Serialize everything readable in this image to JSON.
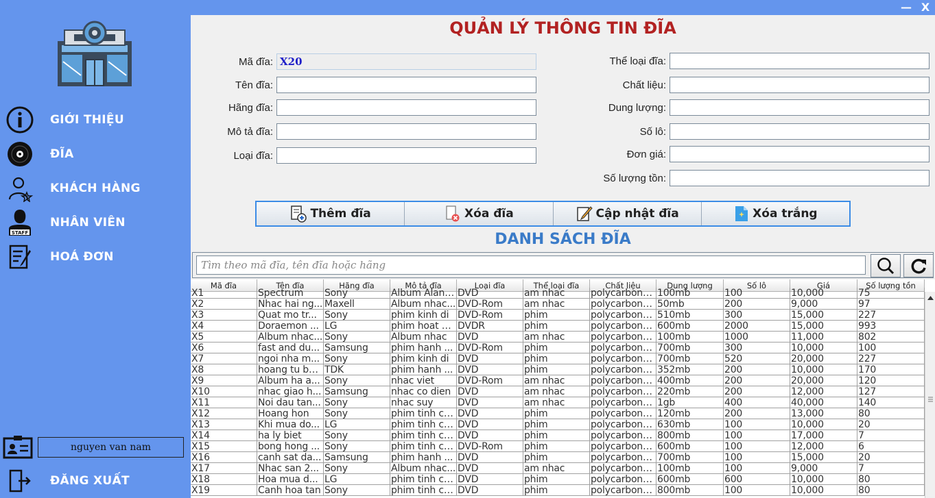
{
  "window": {
    "minimize": "—",
    "close": "X"
  },
  "sidebar": {
    "logo": "disc-store-icon",
    "items": [
      {
        "icon": "info-icon",
        "label": "GIỚI THIỆU"
      },
      {
        "icon": "disc-icon",
        "label": "ĐĨA"
      },
      {
        "icon": "customer-icon",
        "label": "KHÁCH HÀNG"
      },
      {
        "icon": "staff-icon",
        "label": "NHÂN VIÊN"
      },
      {
        "icon": "invoice-icon",
        "label": "HOÁ ĐƠN"
      }
    ],
    "user_icon": "id-card-icon",
    "username": "nguyen van nam",
    "logout_icon": "logout-icon",
    "logout_label": "ĐĂNG XUẤT"
  },
  "form": {
    "title": "QUẢN LÝ THÔNG TIN ĐĨA",
    "left": [
      {
        "label": "Mã đĩa:",
        "value": "X20"
      },
      {
        "label": "Tên đĩa:",
        "value": ""
      },
      {
        "label": "Hãng đĩa:",
        "value": ""
      },
      {
        "label": "Mô tả đĩa:",
        "value": ""
      },
      {
        "label": "Loại đĩa:",
        "value": ""
      }
    ],
    "right": [
      {
        "label": "Thể loại đĩa:",
        "value": ""
      },
      {
        "label": "Chất liệu:",
        "value": ""
      },
      {
        "label": "Dung lượng:",
        "value": ""
      },
      {
        "label": "Số lô:",
        "value": ""
      },
      {
        "label": "Đơn giá:",
        "value": ""
      },
      {
        "label": "Số lượng tồn:",
        "value": ""
      }
    ]
  },
  "actions": {
    "add": "Thêm đĩa",
    "delete": "Xóa đĩa",
    "update": "Cập nhật đĩa",
    "clear": "Xóa trắng"
  },
  "list": {
    "title": "DANH SÁCH ĐĨA",
    "search_placeholder": "Tìm theo mã đĩa, tên đĩa hoặc hãng",
    "columns": [
      "Mã đĩa",
      "Tên đĩa",
      "Hãng đĩa",
      "Mô tả đĩa",
      "Loại đĩa",
      "Thể loại đĩa",
      "Chất liệu",
      "Dung lượng",
      "Số lô",
      "Giá",
      "Số lượng tồn"
    ],
    "rows": [
      [
        "X1",
        "Spectrum",
        "Sony",
        "Album Alan ...",
        "DVD",
        "am nhac",
        "polycarbonate",
        "100mb",
        "100",
        "10,000",
        "75"
      ],
      [
        "X2",
        "Nhac hai ng...",
        "Maxell",
        "Album nhac...",
        "DVD-Rom",
        "am nhac",
        "polycarbonate",
        "50mb",
        "200",
        "9,000",
        "97"
      ],
      [
        "X3",
        "Quat mo tr...",
        "Sony",
        "phim kinh di",
        "DVD-Rom",
        "phim",
        "polycarbona...",
        "510mb",
        "300",
        "15,000",
        "227"
      ],
      [
        "X4",
        "Doraemon ...",
        "LG",
        "phim hoat h...",
        "DVDR",
        "phim",
        "polycarbonate",
        "600mb",
        "2000",
        "15,000",
        "993"
      ],
      [
        "X5",
        "Album nhac...",
        "Sony",
        "Album nhac",
        "DVD",
        "am nhac",
        "polycarbonate",
        "100mb",
        "1000",
        "11,000",
        "802"
      ],
      [
        "X6",
        "fast and du...",
        "Samsung",
        "phim hanh ...",
        "DVD-Rom",
        "phim",
        "polycarbonate",
        "700mb",
        "300",
        "10,000",
        "100"
      ],
      [
        "X7",
        "ngoi nha m...",
        "Sony",
        "phim kinh di",
        "DVD",
        "phim",
        "polycarbona...",
        "700mb",
        "520",
        "20,000",
        "227"
      ],
      [
        "X8",
        "hoang tu ba...",
        "TDK",
        "phim hanh ...",
        "DVD",
        "phim",
        "polycarbonate",
        "352mb",
        "200",
        "10,000",
        "170"
      ],
      [
        "X9",
        "Album ha a...",
        "Sony",
        "nhac viet",
        "DVD-Rom",
        "am nhac",
        "polycarbonate",
        "400mb",
        "200",
        "20,000",
        "120"
      ],
      [
        "X10",
        "nhac giao h...",
        "Samsung",
        "nhac co dien",
        "DVD",
        "am nhac",
        "polycarbonate",
        "220mb",
        "200",
        "12,000",
        "127"
      ],
      [
        "X11",
        "Noi dau tan...",
        "Sony",
        "nhac suy",
        "DVD",
        "am nhac",
        "polycarbona...",
        "1gb",
        "400",
        "40,000",
        "140"
      ],
      [
        "X12",
        "Hoang hon",
        "Sony",
        "phim tinh cam",
        "DVD",
        "phim",
        "polycarbona...",
        "120mb",
        "200",
        "13,000",
        "80"
      ],
      [
        "X13",
        "Khi mua do...",
        "LG",
        "phim tinh cam",
        "DVD",
        "phim",
        "polycarbonate",
        "630mb",
        "100",
        "10,000",
        "20"
      ],
      [
        "X14",
        "ha ly biet",
        "Sony",
        "phim tinh cam",
        "DVD",
        "phim",
        "polycarbonate",
        "800mb",
        "100",
        "17,000",
        "7"
      ],
      [
        "X15",
        "bong hong ...",
        "Sony",
        "phim tinh cam",
        "DVD-Rom",
        "phim",
        "polycarbonate",
        "600mb",
        "100",
        "12,000",
        "6"
      ],
      [
        "X16",
        "canh sat da...",
        "Samsung",
        "phim hanh ...",
        "DVD",
        "phim",
        "polycarbonate",
        "700mb",
        "100",
        "15,000",
        "20"
      ],
      [
        "X17",
        "Nhac san 2...",
        "Sony",
        "Album nhac...",
        "DVD",
        "am nhac",
        "polycarbona...",
        "100mb",
        "100",
        "9,000",
        "7"
      ],
      [
        "X18",
        "Hoa mua d...",
        "LG",
        "phim tinh cam",
        "DVD",
        "phim",
        "polycarbonate",
        "600mb",
        "600",
        "10,000",
        "80"
      ],
      [
        "X19",
        "Canh hoa tan",
        "Sony",
        "phim tinh cam",
        "DVD",
        "phim",
        "polycarbonate",
        "800mb",
        "100",
        "10,000",
        "80"
      ]
    ]
  }
}
